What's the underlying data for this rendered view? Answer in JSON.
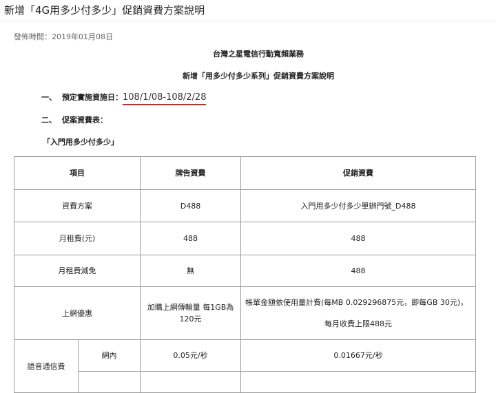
{
  "page": {
    "title": "新增「4G用多少付多少」促銷資費方案說明",
    "publish_time": "發佈時間：2019年01月08日"
  },
  "document": {
    "org_name": "台灣之星電信行動寬頻業務",
    "heading": "新增「用多少付多少系列」促銷資費方案說明",
    "section1_num": "一、",
    "section1_label": "預定實施資施日：",
    "section1_value": "108/1/08-108/2/28",
    "section2_num": "二、",
    "section2_label": "促案資費表：",
    "plan_name": "「入門用多少付多少」"
  },
  "table": {
    "headers": [
      "項目",
      "牌告資費",
      "促銷資費"
    ],
    "rows": [
      {
        "item": "資費方案",
        "list_price": "D488",
        "promo_price": "入門用多少付多少單辦門號_D488"
      },
      {
        "item": "月租費(元)",
        "list_price": "488",
        "promo_price": "488"
      },
      {
        "item": "月租費減免",
        "list_price": "無",
        "promo_price": "488"
      },
      {
        "item": "上網優惠",
        "list_price": "加購上網傳輸量 每1GB為120元",
        "promo_line1": "帳單金額依使用量計費(每MB 0.029296875元，即每GB 30元)，",
        "promo_line2": "每月收費上限488元"
      },
      {
        "item": "語音通信費",
        "sub_item": "網內",
        "list_price": "0.05元/秒",
        "promo_price": "0.01667元/秒"
      }
    ]
  }
}
